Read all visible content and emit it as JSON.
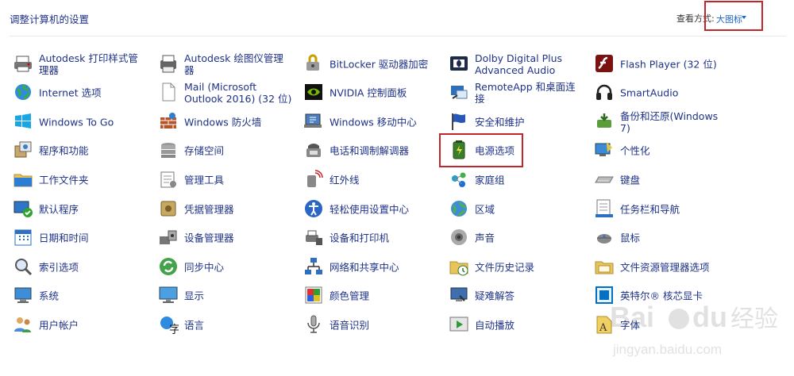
{
  "header": {
    "title": "调整计算机的设置",
    "view_by_label": "查看方式:",
    "view_by_value": "大图标"
  },
  "columns": [
    [
      {
        "name": "autodesk-print-style-manager",
        "label": "Autodesk 打印样式管理器",
        "icon": "printer-icon"
      },
      {
        "name": "internet-options",
        "label": "Internet 选项",
        "icon": "globe-icon"
      },
      {
        "name": "windows-to-go",
        "label": "Windows To Go",
        "icon": "windows-icon"
      },
      {
        "name": "programs-and-features",
        "label": "程序和功能",
        "icon": "program-box-icon"
      },
      {
        "name": "work-folders",
        "label": "工作文件夹",
        "icon": "folder-icon"
      },
      {
        "name": "default-programs",
        "label": "默认程序",
        "icon": "default-programs-icon"
      },
      {
        "name": "date-and-time",
        "label": "日期和时间",
        "icon": "calendar-icon"
      },
      {
        "name": "indexing-options",
        "label": "索引选项",
        "icon": "magnifier-icon"
      },
      {
        "name": "system",
        "label": "系统",
        "icon": "computer-icon"
      },
      {
        "name": "user-accounts",
        "label": "用户帐户",
        "icon": "users-icon"
      }
    ],
    [
      {
        "name": "autodesk-plotter-manager",
        "label": "Autodesk 绘图仪管理器",
        "icon": "plotter-icon"
      },
      {
        "name": "mail",
        "label": "Mail (Microsoft Outlook 2016) (32 位)",
        "icon": "mail-page-icon"
      },
      {
        "name": "windows-firewall",
        "label": "Windows 防火墙",
        "icon": "firewall-icon"
      },
      {
        "name": "storage-spaces",
        "label": "存储空间",
        "icon": "storage-icon"
      },
      {
        "name": "administrative-tools",
        "label": "管理工具",
        "icon": "admin-tools-icon"
      },
      {
        "name": "credential-manager",
        "label": "凭据管理器",
        "icon": "vault-icon"
      },
      {
        "name": "device-manager",
        "label": "设备管理器",
        "icon": "device-manager-icon"
      },
      {
        "name": "sync-center",
        "label": "同步中心",
        "icon": "sync-icon"
      },
      {
        "name": "display",
        "label": "显示",
        "icon": "monitor-icon"
      },
      {
        "name": "language",
        "label": "语言",
        "icon": "language-icon"
      }
    ],
    [
      {
        "name": "bitlocker",
        "label": "BitLocker 驱动器加密",
        "icon": "bitlocker-icon"
      },
      {
        "name": "nvidia-control-panel",
        "label": "NVIDIA 控制面板",
        "icon": "nvidia-icon"
      },
      {
        "name": "windows-mobility-center",
        "label": "Windows 移动中心",
        "icon": "mobility-icon"
      },
      {
        "name": "phone-and-modem",
        "label": "电话和调制解调器",
        "icon": "phone-icon"
      },
      {
        "name": "infrared",
        "label": "红外线",
        "icon": "infrared-icon"
      },
      {
        "name": "ease-of-access-center",
        "label": "轻松使用设置中心",
        "icon": "ease-of-access-icon"
      },
      {
        "name": "devices-and-printers",
        "label": "设备和打印机",
        "icon": "devices-printers-icon"
      },
      {
        "name": "network-and-sharing-center",
        "label": "网络和共享中心",
        "icon": "network-icon"
      },
      {
        "name": "color-management",
        "label": "颜色管理",
        "icon": "color-icon"
      },
      {
        "name": "speech-recognition",
        "label": "语音识别",
        "icon": "microphone-icon"
      }
    ],
    [
      {
        "name": "dolby-digital-plus",
        "label": "Dolby Digital Plus Advanced Audio",
        "icon": "dolby-icon"
      },
      {
        "name": "remoteapp",
        "label": "RemoteApp 和桌面连接",
        "icon": "remoteapp-icon"
      },
      {
        "name": "security-and-maintenance",
        "label": "安全和维护",
        "icon": "flag-icon"
      },
      {
        "name": "power-options",
        "label": "电源选项",
        "icon": "battery-icon",
        "highlighted": true
      },
      {
        "name": "homegroup",
        "label": "家庭组",
        "icon": "homegroup-icon"
      },
      {
        "name": "region",
        "label": "区域",
        "icon": "region-globe-icon"
      },
      {
        "name": "sound",
        "label": "声音",
        "icon": "speaker-icon"
      },
      {
        "name": "file-history",
        "label": "文件历史记录",
        "icon": "file-history-icon"
      },
      {
        "name": "troubleshooting",
        "label": "疑难解答",
        "icon": "troubleshoot-icon"
      },
      {
        "name": "autoplay",
        "label": "自动播放",
        "icon": "autoplay-icon"
      }
    ],
    [
      {
        "name": "flash-player",
        "label": "Flash Player (32 位)",
        "icon": "flash-icon"
      },
      {
        "name": "smartaudio",
        "label": "SmartAudio",
        "icon": "headphones-icon"
      },
      {
        "name": "backup-and-restore",
        "label": "备份和还原(Windows 7)",
        "icon": "backup-icon"
      },
      {
        "name": "personalization",
        "label": "个性化",
        "icon": "personalization-icon"
      },
      {
        "name": "keyboard",
        "label": "键盘",
        "icon": "keyboard-icon"
      },
      {
        "name": "taskbar-and-navigation",
        "label": "任务栏和导航",
        "icon": "taskbar-icon"
      },
      {
        "name": "mouse",
        "label": "鼠标",
        "icon": "mouse-icon"
      },
      {
        "name": "file-explorer-options",
        "label": "文件资源管理器选项",
        "icon": "folder-options-icon"
      },
      {
        "name": "intel-core-graphics",
        "label": "英特尔® 核芯显卡",
        "icon": "intel-icon"
      },
      {
        "name": "fonts",
        "label": "字体",
        "icon": "font-icon"
      }
    ]
  ],
  "watermark": {
    "brand": "Baidu 经验",
    "url": "jingyan.baidu.com"
  },
  "colors": {
    "link": "#1e3287",
    "highlight_border": "#c0272d",
    "view_value": "#1e64c8"
  }
}
